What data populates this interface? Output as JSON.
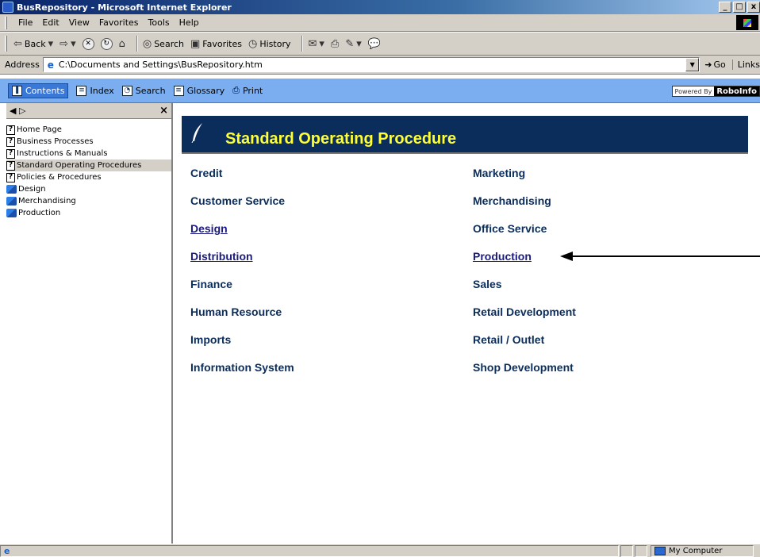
{
  "window": {
    "title": "BusRepository - Microsoft Internet Explorer",
    "min_glyph": "_",
    "max_glyph": "□",
    "close_glyph": "x"
  },
  "menu": [
    "File",
    "Edit",
    "View",
    "Favorites",
    "Tools",
    "Help"
  ],
  "toolbar": {
    "back": "Back",
    "search": "Search",
    "favorites": "Favorites",
    "history": "History"
  },
  "address": {
    "label": "Address",
    "value": "C:\\Documents and Settings\\BusRepository.htm",
    "go": "Go",
    "links": "Links"
  },
  "helpbar": {
    "contents": "Contents",
    "index": "Index",
    "search": "Search",
    "glossary": "Glossary",
    "print": "Print",
    "powered_by": "Powered By",
    "roboinfo": "RoboInfo"
  },
  "toc": [
    {
      "label": "Home Page",
      "icon": "help-page-icon"
    },
    {
      "label": "Business Processes",
      "icon": "help-page-icon"
    },
    {
      "label": "Instructions & Manuals",
      "icon": "help-page-icon"
    },
    {
      "label": "Standard Operating Procedures",
      "icon": "help-page-icon",
      "selected": true
    },
    {
      "label": "Policies & Procedures",
      "icon": "help-page-icon"
    },
    {
      "label": "Design",
      "icon": "book-icon"
    },
    {
      "label": "Merchandising",
      "icon": "book-icon"
    },
    {
      "label": "Production",
      "icon": "book-icon"
    }
  ],
  "content": {
    "banner_title": "Standard Operating Procedure",
    "left_column": [
      {
        "label": "Credit",
        "link": false
      },
      {
        "label": "Customer Service",
        "link": false
      },
      {
        "label": "Design",
        "link": true
      },
      {
        "label": "Distribution",
        "link": true
      },
      {
        "label": "Finance",
        "link": false
      },
      {
        "label": "Human Resource",
        "link": false
      },
      {
        "label": "Imports",
        "link": false
      },
      {
        "label": "Information System",
        "link": false
      }
    ],
    "right_column": [
      {
        "label": "Marketing",
        "link": false
      },
      {
        "label": "Merchandising",
        "link": false
      },
      {
        "label": "Office Service",
        "link": false
      },
      {
        "label": "Production",
        "link": true
      },
      {
        "label": "Sales",
        "link": false
      },
      {
        "label": "Retail Development",
        "link": false
      },
      {
        "label": "Retail / Outlet",
        "link": false
      },
      {
        "label": "Shop Development",
        "link": false
      }
    ]
  },
  "status": {
    "zone": "My Computer"
  },
  "colors": {
    "banner_bg": "#0a2d5c",
    "banner_text": "#ffff33",
    "helpbar_bg": "#7aaef0",
    "link_text": "#1a1a80"
  }
}
